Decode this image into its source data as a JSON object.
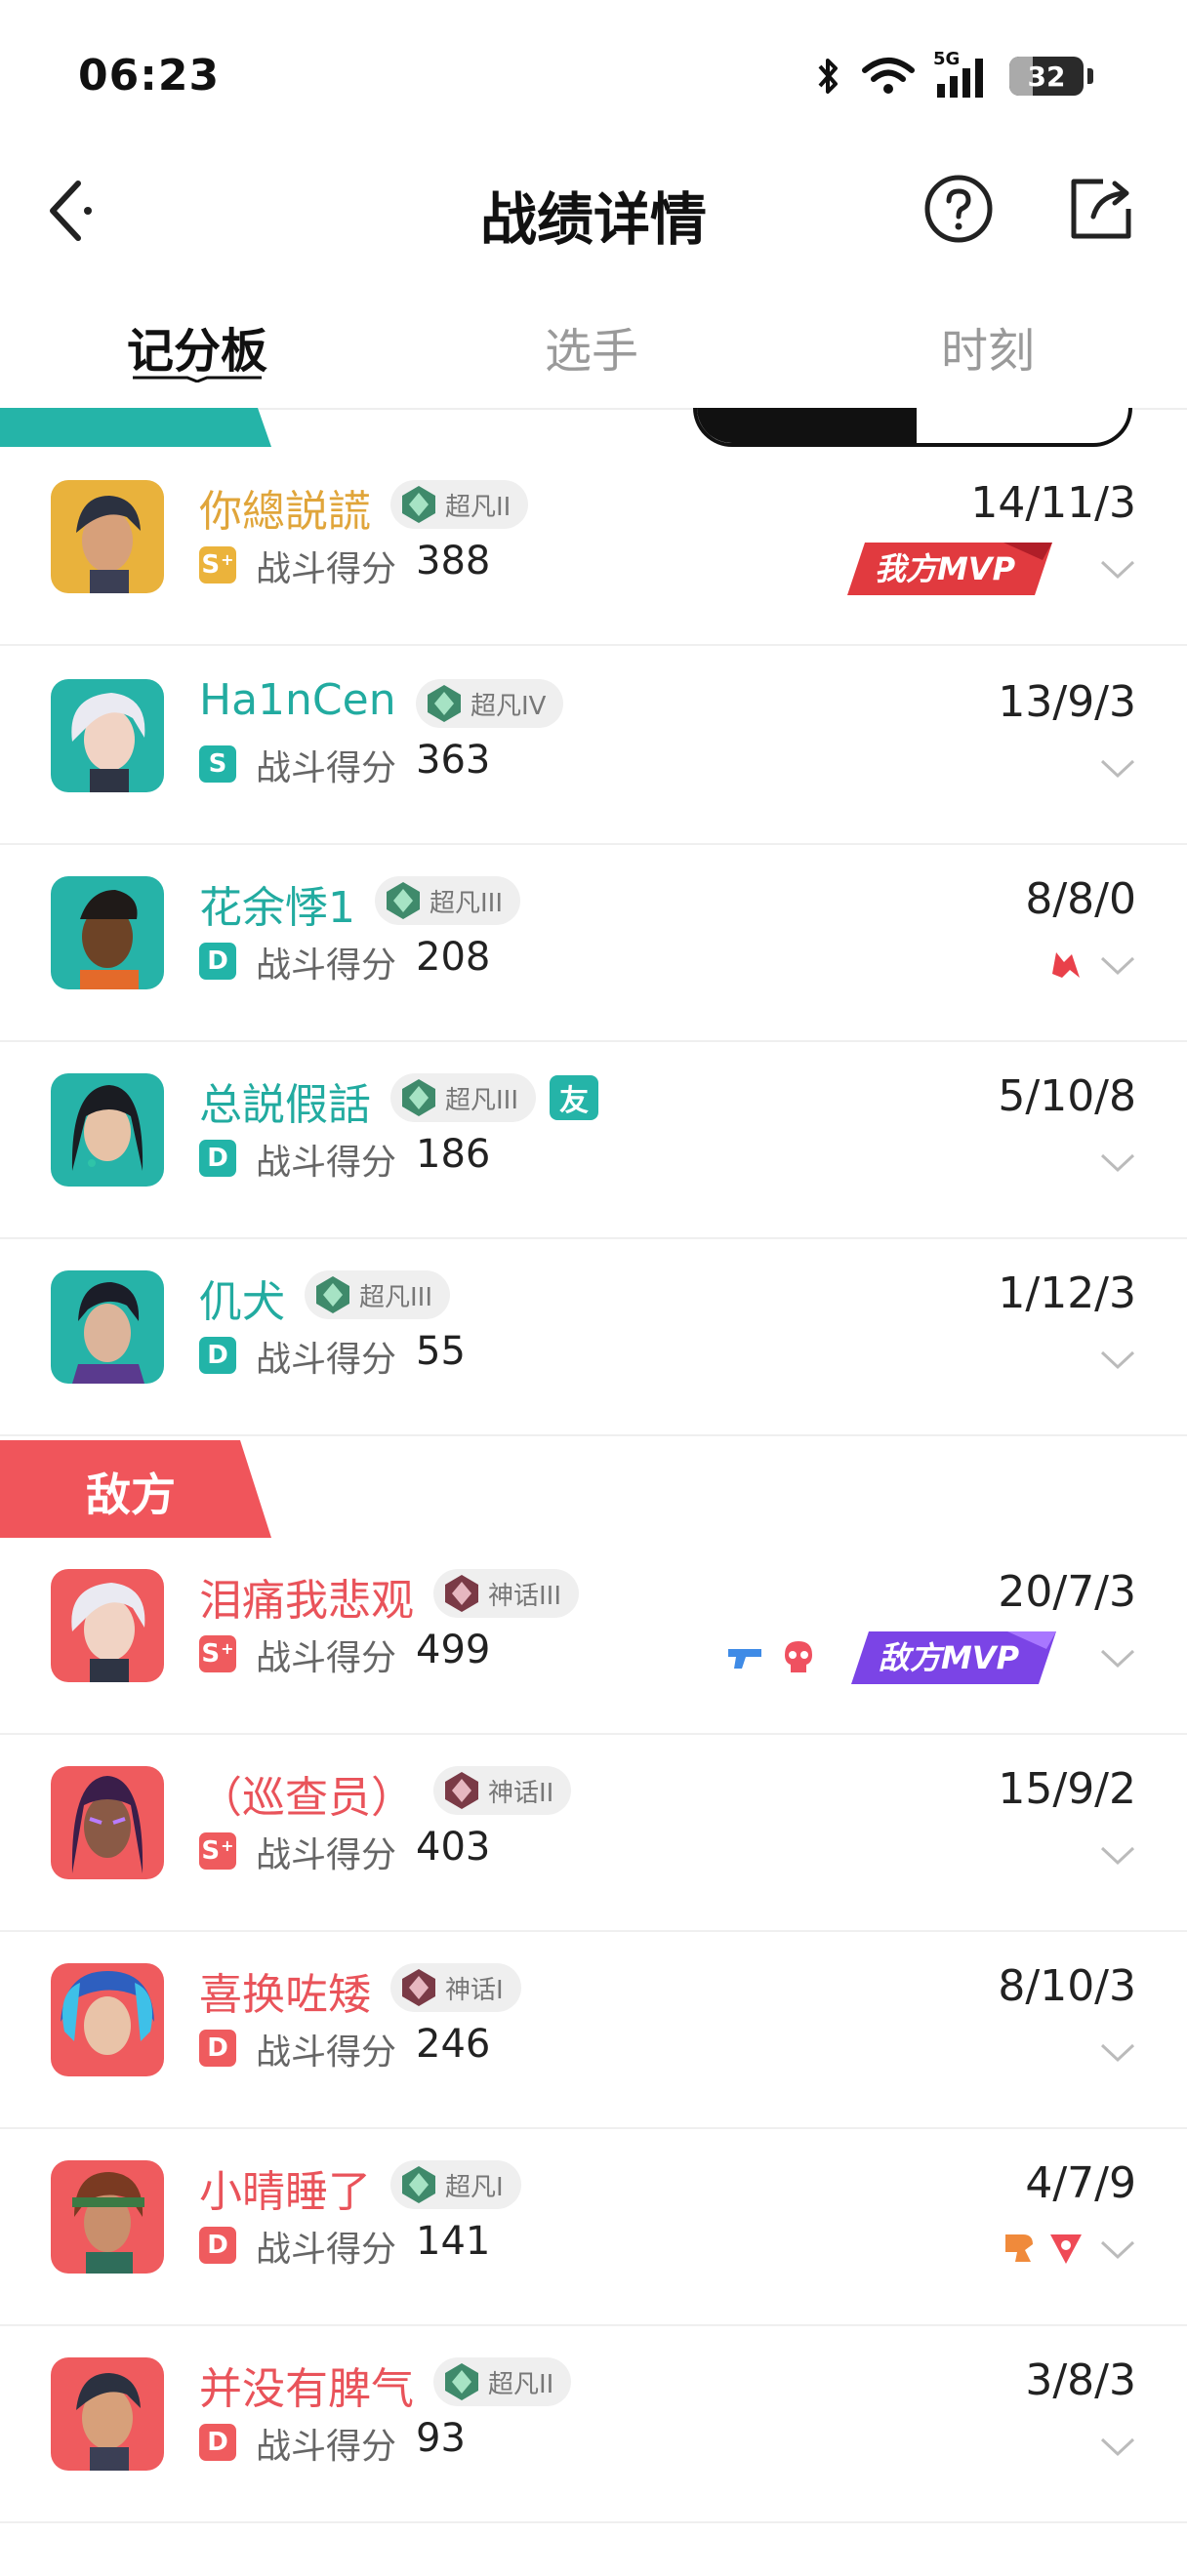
{
  "status_bar": {
    "time": "06:23",
    "network": "5G",
    "battery": "32",
    "battery_level": 0.32
  },
  "nav": {
    "title": "战绩详情",
    "icons": [
      "back-icon",
      "help-icon",
      "share-icon"
    ]
  },
  "tabs": [
    {
      "label": "记分板",
      "active": true
    },
    {
      "label": "选手",
      "active": false
    },
    {
      "label": "时刻",
      "active": false
    }
  ],
  "colors": {
    "ally": "#22aba0",
    "enemy": "#e9535a",
    "self": "#e0a53a",
    "grade_s": "#ebb33b",
    "grade_d": "#22b4a8"
  },
  "score_label": "战斗得分",
  "ally_players": [
    {
      "name": "你總説謊",
      "rank": "超凡II",
      "grade": "S",
      "grade_plus": "+",
      "score": "388",
      "kda": "14/11/3",
      "mvp": "我方MVP",
      "self": true
    },
    {
      "name": "Ha1nCen",
      "rank": "超凡IV",
      "grade": "S",
      "grade_plus": "",
      "score": "363",
      "kda": "13/9/3"
    },
    {
      "name": "花余悸1",
      "rank": "超凡III",
      "grade": "D",
      "grade_plus": "",
      "score": "208",
      "kda": "8/8/0",
      "icon": "revive-icon"
    },
    {
      "name": "总説假話",
      "rank": "超凡III",
      "grade": "D",
      "grade_plus": "",
      "score": "186",
      "kda": "5/10/8",
      "friend": "友"
    },
    {
      "name": "仉犬",
      "rank": "超凡III",
      "grade": "D",
      "grade_plus": "",
      "score": "55",
      "kda": "1/12/3"
    }
  ],
  "enemy_section": {
    "label": "敌方"
  },
  "enemy_players": [
    {
      "name": "泪痛我悲观",
      "rank": "神话III",
      "grade": "S",
      "grade_plus": "+",
      "score": "499",
      "kda": "20/7/3",
      "mvp": "敌方MVP"
    },
    {
      "name": "（巡查员）",
      "rank": "神话II",
      "grade": "S",
      "grade_plus": "+",
      "score": "403",
      "kda": "15/9/2"
    },
    {
      "name": "喜换咗矮",
      "rank": "神话I",
      "grade": "D",
      "grade_plus": "",
      "score": "246",
      "kda": "8/10/3"
    },
    {
      "name": "小晴睡了",
      "rank": "超凡I",
      "grade": "D",
      "grade_plus": "",
      "score": "141",
      "kda": "4/7/9"
    },
    {
      "name": "并没有脾气",
      "rank": "超凡II",
      "grade": "D",
      "grade_plus": "",
      "score": "93",
      "kda": "3/8/3"
    }
  ]
}
